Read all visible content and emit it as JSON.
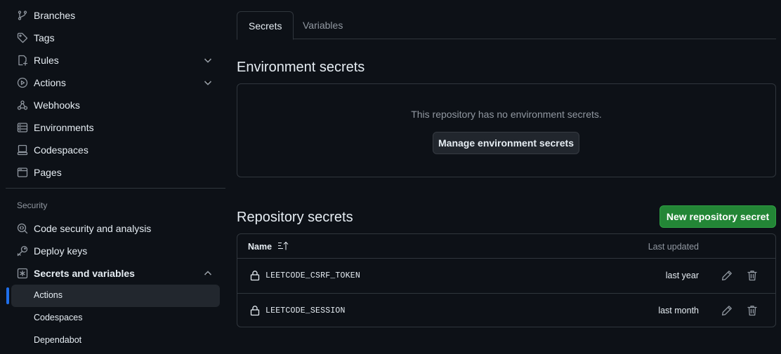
{
  "sidebar": {
    "items": [
      {
        "label": "Branches",
        "icon": "git-branch-icon"
      },
      {
        "label": "Tags",
        "icon": "tag-icon"
      },
      {
        "label": "Rules",
        "icon": "rules-icon",
        "expandable": true
      },
      {
        "label": "Actions",
        "icon": "play-icon",
        "expandable": true
      },
      {
        "label": "Webhooks",
        "icon": "webhook-icon"
      },
      {
        "label": "Environments",
        "icon": "server-icon"
      },
      {
        "label": "Codespaces",
        "icon": "codespaces-icon"
      },
      {
        "label": "Pages",
        "icon": "browser-icon"
      }
    ],
    "security_heading": "Security",
    "security_items": [
      {
        "label": "Code security and analysis",
        "icon": "codescan-icon"
      },
      {
        "label": "Deploy keys",
        "icon": "key-icon"
      },
      {
        "label": "Secrets and variables",
        "icon": "asterisk-icon",
        "expanded": true
      }
    ],
    "sub_items": [
      {
        "label": "Actions",
        "active": true
      },
      {
        "label": "Codespaces"
      },
      {
        "label": "Dependabot"
      }
    ]
  },
  "tabs": [
    {
      "label": "Secrets",
      "selected": true
    },
    {
      "label": "Variables"
    }
  ],
  "environment": {
    "title": "Environment secrets",
    "empty_text": "This repository has no environment secrets.",
    "manage_button": "Manage environment secrets"
  },
  "repository": {
    "title": "Repository secrets",
    "new_button": "New repository secret",
    "columns": {
      "name": "Name",
      "updated": "Last updated"
    },
    "secrets": [
      {
        "name": "LEETCODE_CSRF_TOKEN",
        "updated": "last year"
      },
      {
        "name": "LEETCODE_SESSION",
        "updated": "last month"
      }
    ]
  },
  "colors": {
    "background": "#0d1117",
    "border": "#30363d",
    "primary_button": "#238636",
    "active_marker": "#1f6feb",
    "muted_text": "#9198a1"
  }
}
